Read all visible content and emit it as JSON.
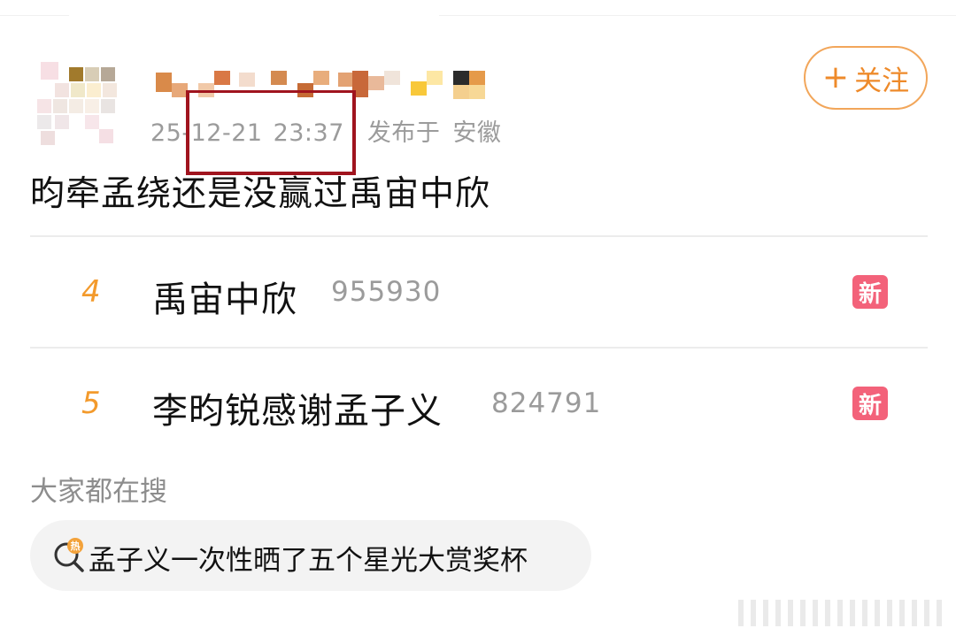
{
  "post": {
    "username": "",
    "date": "25-12-21",
    "time": "23:37",
    "published_label": "发布于",
    "location": "安徽",
    "follow_label": "关注",
    "text": "昀牵孟绕还是没赢过禹宙中欣"
  },
  "hot_list": [
    {
      "rank": "4",
      "title": "禹宙中欣",
      "count": "955930",
      "badge": "新"
    },
    {
      "rank": "5",
      "title": "李昀锐感谢孟子义",
      "count": "824791",
      "badge": "新"
    }
  ],
  "search": {
    "heading": "大家都在搜",
    "suggestion": "孟子义一次性晒了五个星光大赏奖杯",
    "suggestion_icon_text": "热"
  },
  "colors": {
    "accent_orange": "#ee8a2a",
    "rank_orange": "#f39a2c",
    "badge_pink": "#f3627a",
    "annotation_red": "#a0141e"
  },
  "icons": [
    "plus-icon",
    "hot-search-icon"
  ]
}
